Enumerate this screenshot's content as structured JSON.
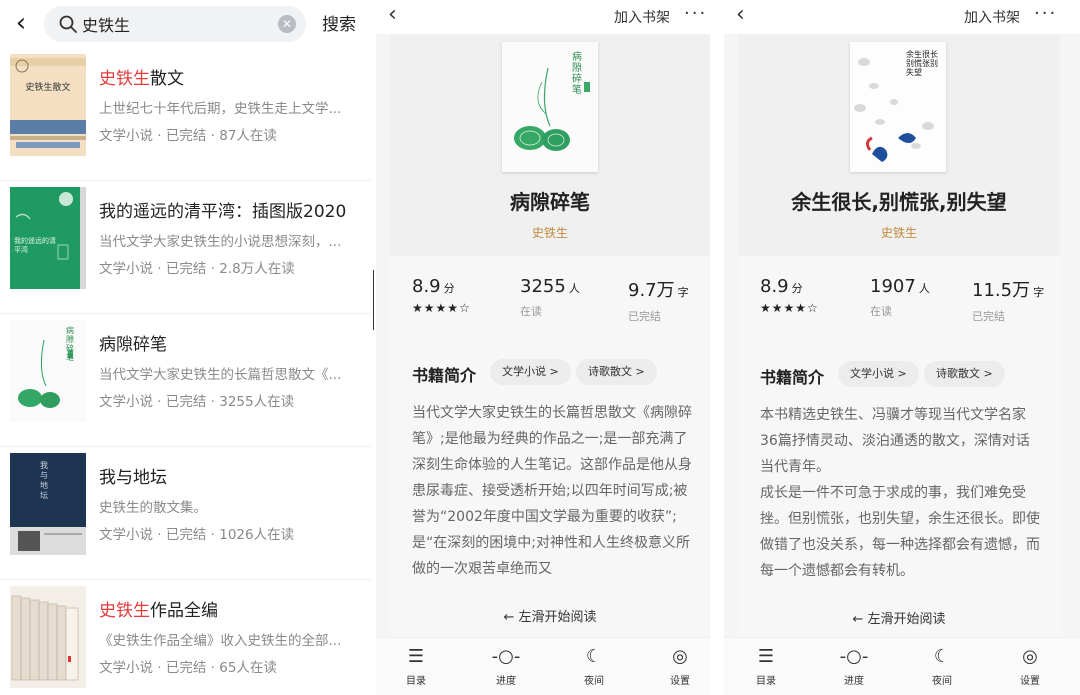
{
  "search": {
    "query": "史铁生",
    "search_button": "搜索",
    "results": [
      {
        "title_highlight": "史铁生",
        "title_rest": "散文",
        "description": "上世纪七十年代后期，史铁生走上文学...",
        "meta": "文学小说 · 已完结 · 87人在读",
        "cover_text": "史铁生散文"
      },
      {
        "title_highlight": "",
        "title_rest": "我的遥远的清平湾：插图版2020",
        "description": "当代文学大家史铁生的小说思想深刻，...",
        "meta": "文学小说 · 已完结 · 2.8万人在读",
        "cover_text": "我的遥远的清平湾"
      },
      {
        "title_highlight": "",
        "title_rest": "病隙碎笔",
        "description": "当代文学大家史铁生的长篇哲思散文《...",
        "meta": "文学小说 · 已完结 · 3255人在读",
        "cover_text": "病隙碎笔"
      },
      {
        "title_highlight": "",
        "title_rest": "我与地坛",
        "description": "史铁生的散文集。",
        "meta": "文学小说 · 已完结 · 1026人在读",
        "cover_text": "我与地坛"
      },
      {
        "title_highlight": "史铁生",
        "title_rest": "作品全编",
        "description": "《史铁生作品全编》收入史铁生的全部...",
        "meta": "文学小说 · 已完结 · 65人在读",
        "cover_text": ""
      }
    ]
  },
  "book_a": {
    "add_shelf": "加入书架",
    "more": "···",
    "cover_text": "病隙碎笔",
    "title": "病隙碎笔",
    "author": "史铁生",
    "rating": "8.9",
    "rating_unit": "分",
    "stars": "★★★★☆",
    "readers": "3255",
    "readers_unit": "人",
    "readers_label": "在读",
    "words": "9.7万",
    "words_unit": "字",
    "words_label": "已完结",
    "intro_title": "书籍简介",
    "tag1": "文学小说 >",
    "tag2": "诗歌散文 >",
    "intro": "当代文学大家史铁生的长篇哲思散文《病隙碎笔》;是他最为经典的作品之一;是一部充满了深刻生命体验的人生笔记。这部作品是他从身患尿毒症、接受透析开始;以四年时间写成;被誉为“2002年度中国文学最为重要的收获”;是“在深刻的困境中;对神性和人生终极意义所做的一次艰苦卓绝而又",
    "swipe": "← 左滑开始阅读"
  },
  "book_b": {
    "add_shelf": "加入书架",
    "more": "···",
    "cover_text": "余生很长别慌张别失望",
    "title": "余生很长,别慌张,别失望",
    "author": "史铁生",
    "rating": "8.9",
    "rating_unit": "分",
    "stars": "★★★★☆",
    "readers": "1907",
    "readers_unit": "人",
    "readers_label": "在读",
    "words": "11.5万",
    "words_unit": "字",
    "words_label": "已完结",
    "intro_title": "书籍简介",
    "tag1": "文学小说 >",
    "tag2": "诗歌散文 >",
    "intro_p1": "本书精选史铁生、冯骥才等现当代文学名家36篇抒情灵动、淡泊通透的散文，深情对话当代青年。",
    "intro_p2": "成长是一件不可急于求成的事，我们难免受挫。但别慌张，也别失望，余生还很长。即使做错了也没关系，每一种选择都会有遗憾，而每一个遗憾都会有转机。",
    "swipe": "← 左滑开始阅读"
  },
  "toolbar": {
    "toc": "目录",
    "progress": "进度",
    "night": "夜间",
    "settings": "设置"
  }
}
